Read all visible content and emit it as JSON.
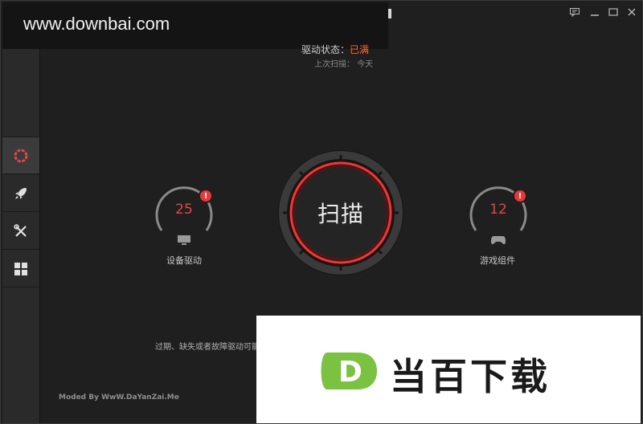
{
  "watermark": {
    "text": "www.downbai.com"
  },
  "status": {
    "label": "驱动状态：",
    "value": "已满",
    "last_scan": "上次扫描：  今天"
  },
  "scan": {
    "label": "扫描"
  },
  "gauges": [
    {
      "value": "25",
      "label": "设备驱动",
      "icon": "monitor-icon",
      "alert": "!"
    },
    {
      "value": "12",
      "label": "游戏组件",
      "icon": "gamepad-icon",
      "alert": "!"
    }
  ],
  "hint": "过期、缺失或者故障驱动可能",
  "footer": {
    "moded_by": "Moded By WwW.DaYanZai.Me"
  },
  "logo": {
    "mark": "D",
    "text": "当百下载"
  },
  "sidebar": {
    "items": [
      {
        "icon": "scan-ring-icon"
      },
      {
        "icon": "rocket-icon"
      },
      {
        "icon": "tools-icon"
      },
      {
        "icon": "grid-icon"
      }
    ]
  },
  "colors": {
    "accent_red": "#e64545",
    "status_orange": "#ff6a3d",
    "logo_green": "#7cc242"
  }
}
